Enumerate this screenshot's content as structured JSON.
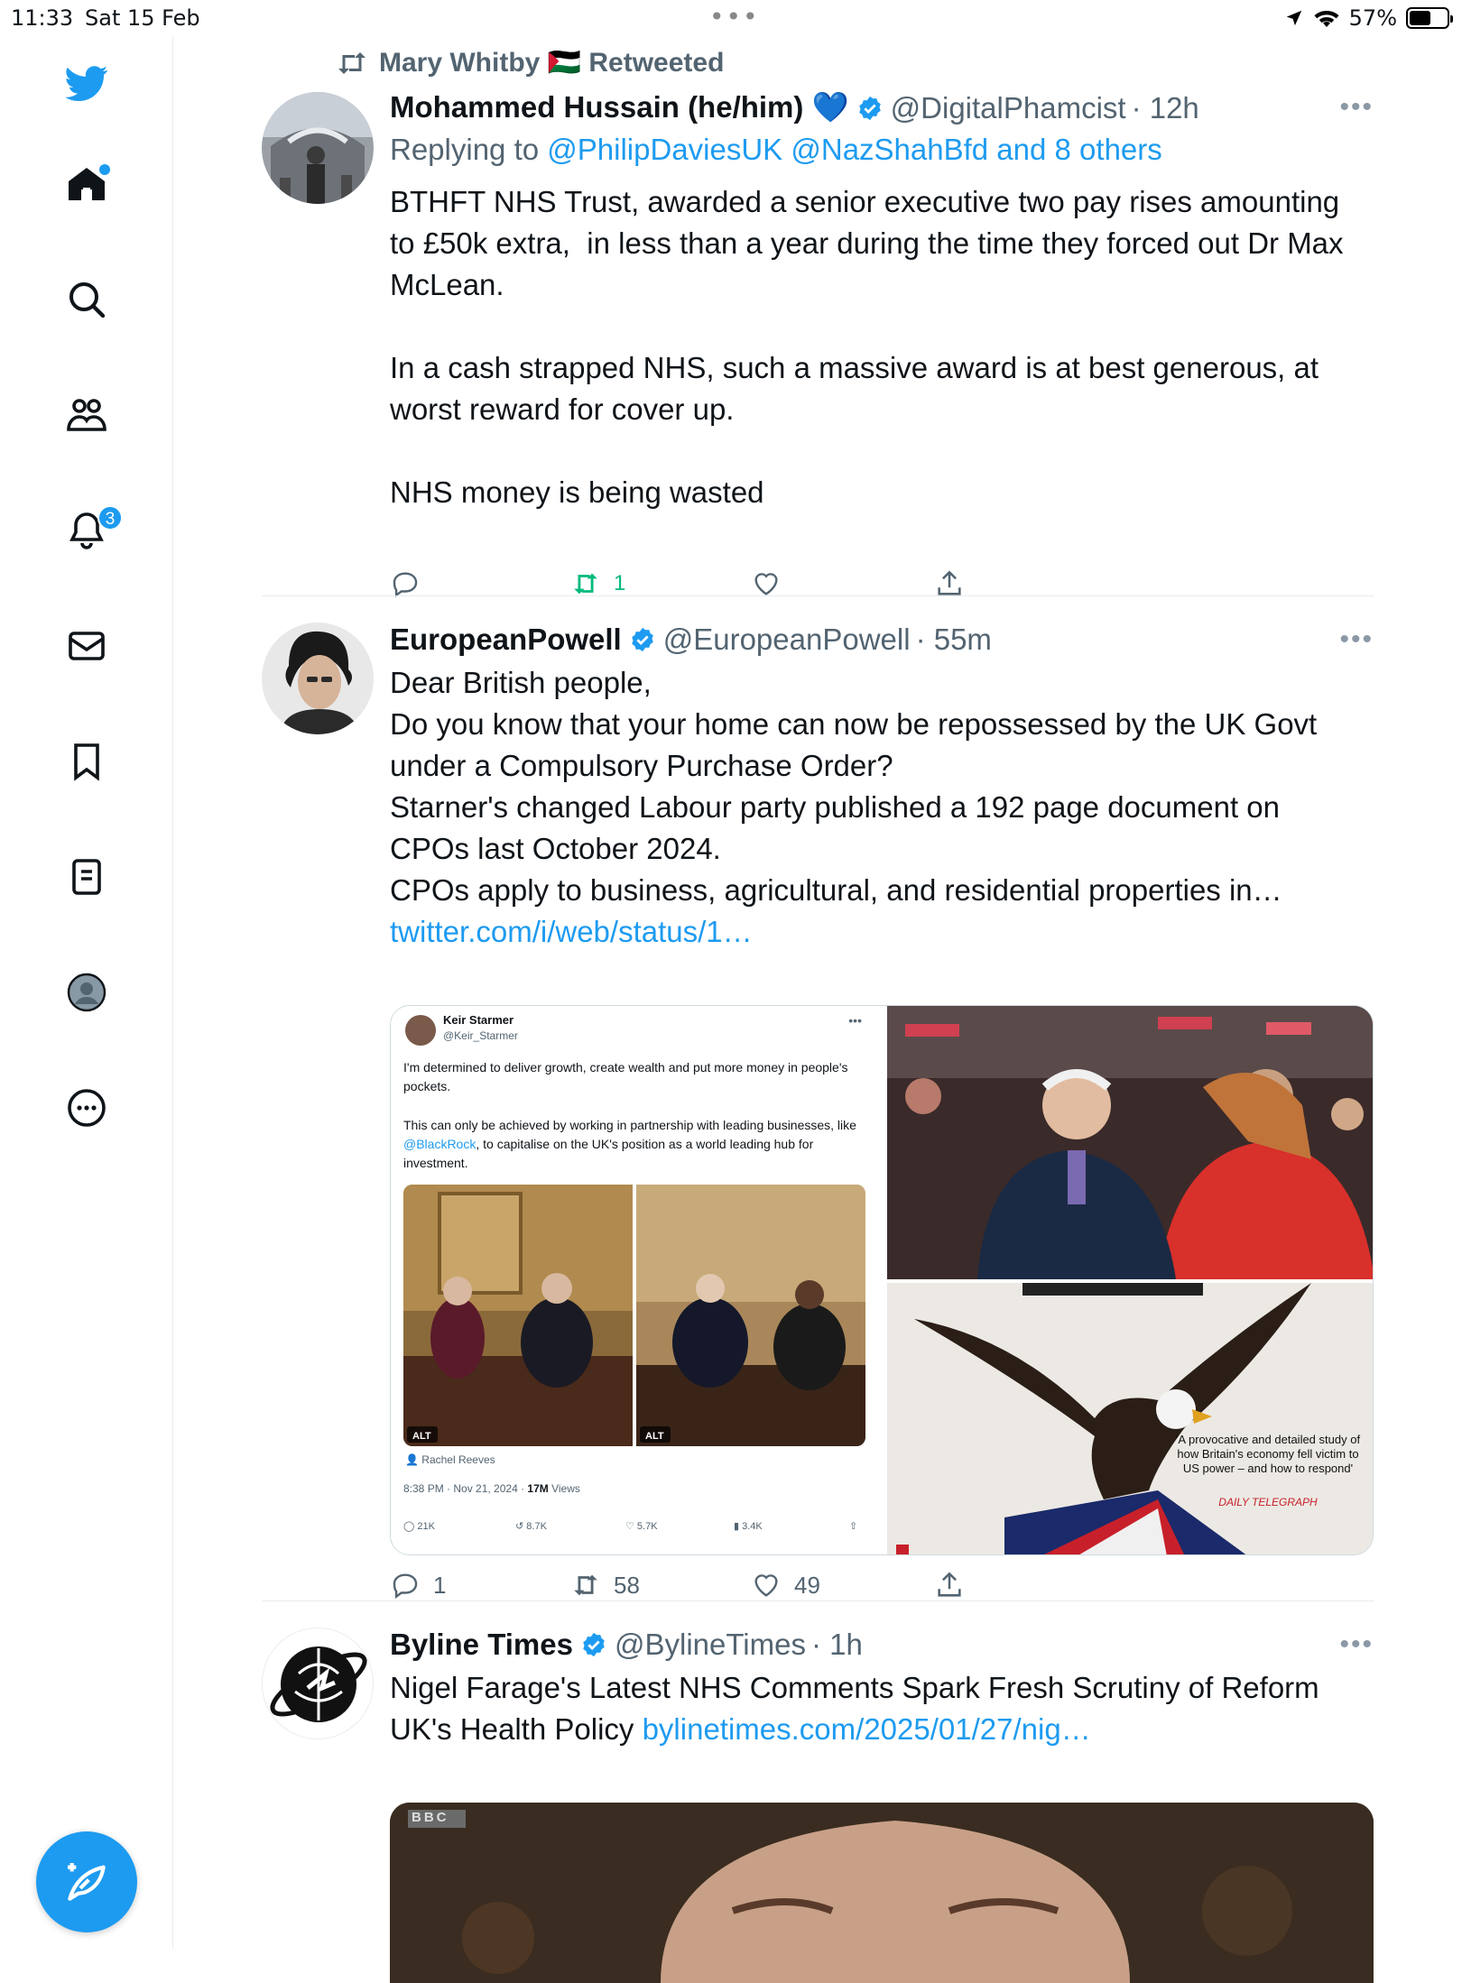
{
  "status": {
    "time": "11:33",
    "date": "Sat 15 Feb",
    "battery": "57%",
    "battery_level": 0.57
  },
  "sidebar": {
    "items": [
      {
        "name": "home",
        "icon": "home-icon"
      },
      {
        "name": "explore",
        "icon": "search-icon"
      },
      {
        "name": "communities",
        "icon": "people-icon"
      },
      {
        "name": "notifications",
        "icon": "bell-icon",
        "badge": "3"
      },
      {
        "name": "messages",
        "icon": "mail-icon"
      },
      {
        "name": "bookmarks",
        "icon": "bookmark-icon"
      },
      {
        "name": "lists",
        "icon": "list-icon"
      },
      {
        "name": "profile",
        "icon": "profile-icon"
      },
      {
        "name": "more",
        "icon": "more-icon"
      }
    ],
    "accent": "#1d9bf0"
  },
  "tweets": [
    {
      "retweeted_by": "Mary Whitby 🇵🇸 Retweeted",
      "name": "Mohammed Hussain (he/him) 💙",
      "handle": "@DigitalPhamcist",
      "time": "· 12h",
      "reply_prefix": "Replying to ",
      "reply_to": "@PhilipDaviesUK @NazShahBfd and 8 others",
      "text": "BTHFT NHS Trust, awarded a senior executive two pay rises amounting to £50k extra,  in less than a year during the time they forced out Dr Max McLean.\n\nIn a cash strapped NHS, such a massive award is at best generous, at worst reward for cover up.\n\nNHS money is being wasted",
      "replies": "",
      "retweets": "1",
      "likes": ""
    },
    {
      "name": "EuropeanPowell",
      "handle": "@EuropeanPowell",
      "time": "· 55m",
      "text": "Dear British people,\nDo you know that your home can now be repossessed by the UK Govt under a Compulsory Purchase Order?\nStarner's changed Labour party published a 192 page document on CPOs last October 2024.\nCPOs apply to business, agricultural, and residential properties in…",
      "link": "twitter.com/i/web/status/1…",
      "embedded": {
        "name": "Keir Starmer",
        "handle": "@Keir_Starmer",
        "text1": "I'm determined to deliver growth, create wealth and put more money in people's pockets.",
        "text2a": "This can only be achieved by working in partnership with leading businesses, like ",
        "text2link": "@BlackRock",
        "text2b": ", to capitalise on the UK's position as a world leading hub for investment.",
        "alt": "ALT",
        "tagged": "Rachel Reeves",
        "meta": "8:38 PM · Nov 21, 2024 · ",
        "views": "17M",
        "views_label": " Views",
        "replies": "21K",
        "retweets": "8.7K",
        "likes": "5.7K",
        "bookmarks": "3.4K"
      },
      "book_quote": "'A provocative and detailed study of how Britain's economy fell victim to US power – and how to respond'",
      "book_source": "DAILY TELEGRAPH",
      "replies": "1",
      "retweets": "58",
      "likes": "49"
    },
    {
      "name": "Byline Times",
      "handle": "@BylineTimes",
      "time": "· 1h",
      "text": "Nigel Farage's Latest NHS Comments Spark Fresh Scrutiny of Reform UK's Health Policy ",
      "link": "bylinetimes.com/2025/01/27/nig…",
      "image_logo": "BBC"
    }
  ]
}
